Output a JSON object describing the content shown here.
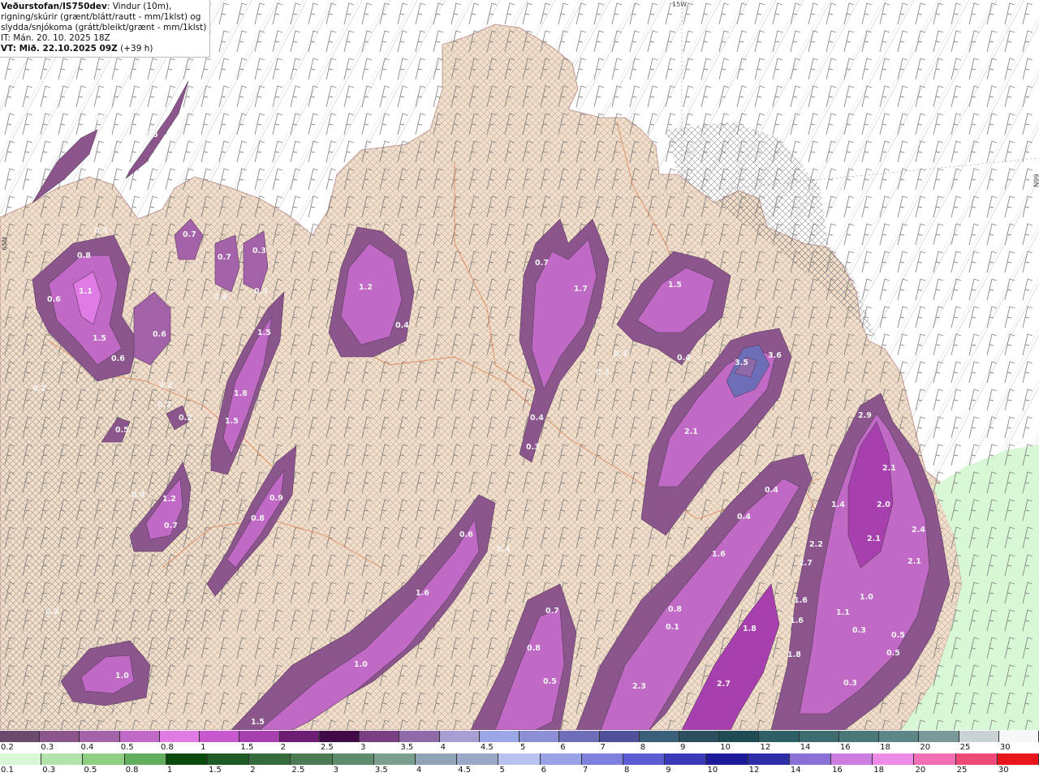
{
  "header": {
    "source": "Veðurstofan/IS750dev",
    "desc_1": ": Vindur (10m),",
    "desc_2": "rigning/skúrir (grænt/blátt/rautt - mm/1klst) og",
    "desc_3": "slydda/snjókoma (grátt/bleikt/grænt - mm/1klst)",
    "issue_time": "IT: Mán. 20. 10. 2025 18Z",
    "valid_time": "VT: Mið. 22.10.2025 09Z",
    "lead_time": "(+39 h)"
  },
  "grid_labels": {
    "top": "15W",
    "right": "66N",
    "left": "65N"
  },
  "map_values": {
    "v01": "0.4",
    "v02": "0.5",
    "v03": "0.5",
    "v04": "0.8",
    "v05": "0.6",
    "v06": "1.1",
    "v07": "1.5",
    "v08": "0.6",
    "v09": "0.6",
    "v10": "0.2",
    "v11": "0.3",
    "v12": "0.5",
    "v13": "0.2",
    "v14": "0.7",
    "v15": "0.7",
    "v16": "0.4",
    "v17": "0.3",
    "v18": "0.5",
    "v19": "1.5",
    "v20": "1.8",
    "v21": "1.5",
    "v22": "1.2",
    "v23": "0.4",
    "v24": "0.4",
    "v25": "1.2",
    "v26": "0.7",
    "v27": "0.9",
    "v28": "0.8",
    "v29": "0.2",
    "v30": "1.0",
    "v31": "0.7",
    "v32": "1.7",
    "v33": "0.3",
    "v34": "0.3",
    "v35": "0.4",
    "v36": "0.3",
    "v37": "1.5",
    "v38": "0.4",
    "v39": "3.5",
    "v40": "3.6",
    "v41": "2.1",
    "v42": "2.9",
    "v43": "2.1",
    "v44": "0.4",
    "v45": "1.4",
    "v46": "2.0",
    "v47": "2.4",
    "v48": "2.1",
    "v49": "2.1",
    "v50": "0.4",
    "v51": "2.2",
    "v52": "2.7",
    "v53": "1.6",
    "v54": "1.6",
    "v55": "1.6",
    "v56": "1.0",
    "v57": "1.1",
    "v58": "1.0",
    "v59": "1.6",
    "v60": "0.3",
    "v61": "0.5",
    "v62": "0.8",
    "v63": "0.7",
    "v64": "1.8",
    "v65": "0.8",
    "v66": "0.1",
    "v67": "2.3",
    "v68": "2.7",
    "v69": "1.8",
    "v70": "0.5",
    "v71": "0.3",
    "v72": "0.5",
    "v73": "0.6",
    "v74": "1.5",
    "v75": "0.4",
    "v76": "0.2"
  },
  "legend_snow": {
    "labels": [
      "0.2",
      "0.3",
      "0.4",
      "0.5",
      "0.8",
      "1",
      "1.5",
      "2",
      "2.5",
      "3",
      "3.5",
      "4",
      "4.5",
      "5",
      "6",
      "7",
      "8",
      "9",
      "10",
      "12",
      "14",
      "16",
      "18",
      "20",
      "25",
      "30"
    ],
    "colors": [
      "#6b4a6d",
      "#8a568c",
      "#a462a8",
      "#c06ac6",
      "#e07be6",
      "#c858ce",
      "#a83fae",
      "#6e1d74",
      "#3f0a45",
      "#7a3e82",
      "#8e6aa8",
      "#a89ed3",
      "#9aa6e6",
      "#8d8fd6",
      "#6e6eb8",
      "#50509a",
      "#3a5f78",
      "#2b4f5f",
      "#1f4b55",
      "#2e5f66",
      "#3c6c70",
      "#4a7878",
      "#5d8686",
      "#7a9a9a",
      "#c9d3d6",
      "#f6f8f8"
    ]
  },
  "legend_rain": {
    "labels": [
      "0.1",
      "0.3",
      "0.5",
      "0.8",
      "1",
      "1.5",
      "2",
      "2.5",
      "3",
      "3.5",
      "4",
      "4.5",
      "5",
      "6",
      "7",
      "8",
      "9",
      "10",
      "12",
      "14",
      "16",
      "18",
      "20",
      "25",
      "30"
    ],
    "colors": [
      "#d8f7d4",
      "#b2e3a8",
      "#8fcf84",
      "#63ae5e",
      "#0a4a0a",
      "#1f5b25",
      "#356b3d",
      "#4a7b55",
      "#5d8b6b",
      "#7a9f8d",
      "#8ea3b6",
      "#9aa8c8",
      "#b8c2ee",
      "#9aa2e6",
      "#7d80dc",
      "#5b5cd2",
      "#3a39b8",
      "#1d1a9a",
      "#2e2ea8",
      "#8870d6",
      "#cc7ee0",
      "#ee8ae8",
      "#f16fb5",
      "#ef4a77",
      "#e8161d"
    ]
  }
}
